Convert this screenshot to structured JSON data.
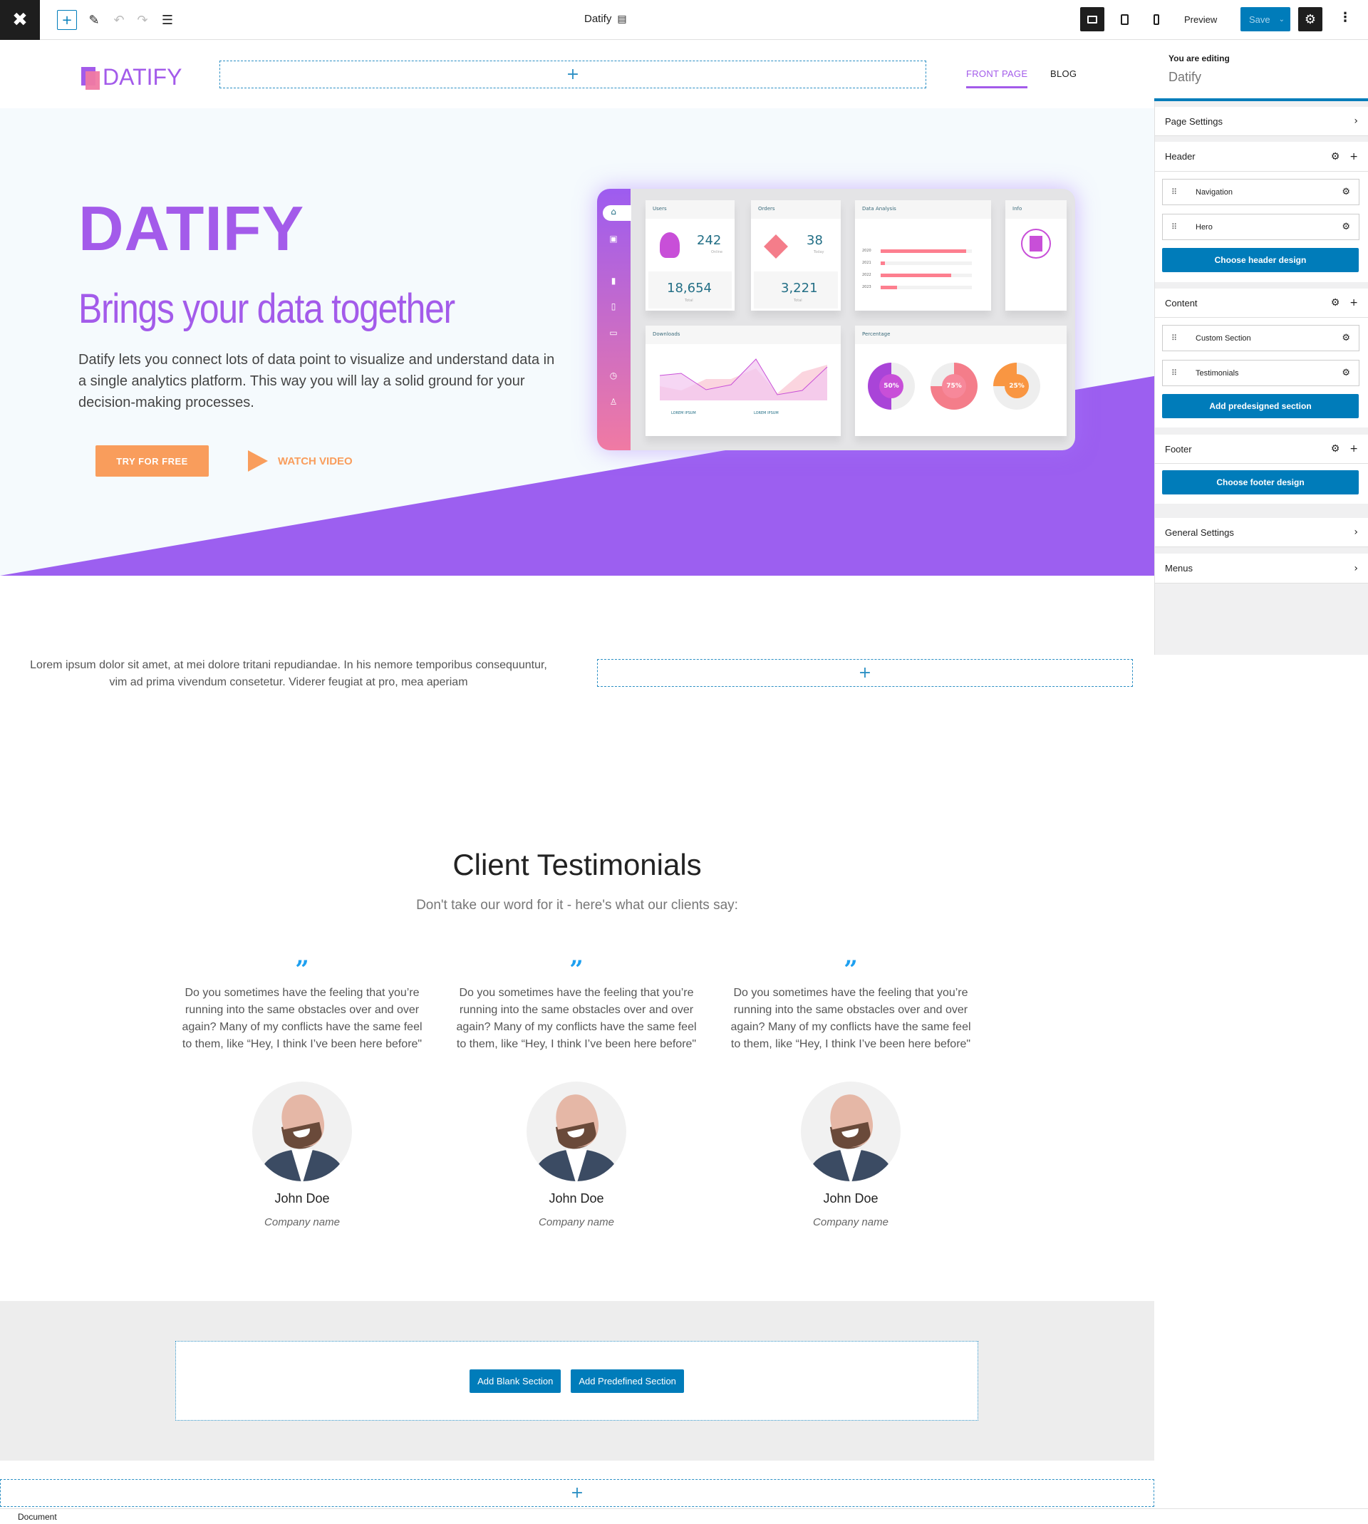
{
  "topbar": {
    "logo_icon": "wordpress-block-icon",
    "add_icon": "+",
    "edit_icon": "pencil-icon",
    "undo_icon": "undo-icon",
    "redo_icon": "redo-icon",
    "list_icon": "list-view-icon",
    "document_title": "Datify",
    "preview_label": "Preview",
    "save_label": "Save",
    "active_device": "desktop"
  },
  "site_header": {
    "logo_text": "DATIFY",
    "add_block": "+",
    "nav": [
      {
        "label": "FRONT PAGE",
        "active": true
      },
      {
        "label": "BLOG",
        "active": false
      }
    ]
  },
  "hero": {
    "title": "DATIFY",
    "subtitle": "Brings your data together",
    "text": "Datify lets you connect lots of data point to visualize and understand data in a single analytics platform. This way you will lay a solid ground for your decision-making processes.",
    "cta_label": "TRY FOR FREE",
    "video_label": "WATCH VIDEO",
    "colors": {
      "purple": "#9c5ff0",
      "title": "#a35bea",
      "orange": "#f99d5c"
    },
    "dashboard": {
      "users": {
        "title": "Users",
        "value": "242",
        "sub": "Online",
        "total": "18,654",
        "total_label": "Total"
      },
      "orders": {
        "title": "Orders",
        "value": "38",
        "sub": "Today",
        "total": "3,221",
        "total_label": "Total"
      },
      "analysis": {
        "title": "Data Analysis",
        "years": [
          "2020",
          "2021",
          "2022",
          "2023"
        ],
        "fills": [
          0.94,
          0.05,
          0.77,
          0.18
        ]
      },
      "info": {
        "title": "Info"
      },
      "downloads": {
        "title": "Downloads",
        "legend": [
          "LOREM IPSUM",
          "LOREM IPSUM"
        ]
      },
      "percentage": {
        "title": "Percentage",
        "rings": [
          "50%",
          "75%",
          "25%"
        ]
      }
    }
  },
  "custom_section": {
    "text": "Lorem ipsum dolor sit amet, at mei dolore tritani repudiandae. In his nemore temporibus consequuntur, vim ad prima vivendum consetetur. Viderer feugiat at pro, mea aperiam",
    "add_block": "+"
  },
  "testimonials": {
    "title": "Client Testimonials",
    "subtitle": "Don't take our word for it - here's what our clients say:",
    "quote_icon": "quote-icon",
    "items": [
      {
        "text": "Do you sometimes have the feeling that you’re running into the same obstacles over and over again? Many of my conflicts have the same feel to them, like “Hey, I think I’ve been here before\"",
        "name": "John Doe",
        "company": "Company name"
      },
      {
        "text": "Do you sometimes have the feeling that you’re running into the same obstacles over and over again? Many of my conflicts have the same feel to them, like “Hey, I think I’ve been here before\"",
        "name": "John Doe",
        "company": "Company name"
      },
      {
        "text": "Do you sometimes have the feeling that you’re running into the same obstacles over and over again? Many of my conflicts have the same feel to them, like “Hey, I think I’ve been here before\"",
        "name": "John Doe",
        "company": "Company name"
      }
    ]
  },
  "add_section": {
    "blank_label": "Add Blank Section",
    "predefined_label": "Add Predefined Section",
    "add_block": "+"
  },
  "statusbar": {
    "text": "Document"
  },
  "sidebar": {
    "editing_label": "You are editing",
    "editing_name": "Datify",
    "page_settings": "Page Settings",
    "header": {
      "title": "Header",
      "items": [
        "Navigation",
        "Hero"
      ],
      "button": "Choose header design"
    },
    "content": {
      "title": "Content",
      "items": [
        "Custom Section",
        "Testimonials"
      ],
      "button": "Add predesigned section"
    },
    "footer": {
      "title": "Footer",
      "button": "Choose footer design"
    },
    "general_settings": "General Settings",
    "menus": "Menus",
    "accent": "#007cba"
  }
}
